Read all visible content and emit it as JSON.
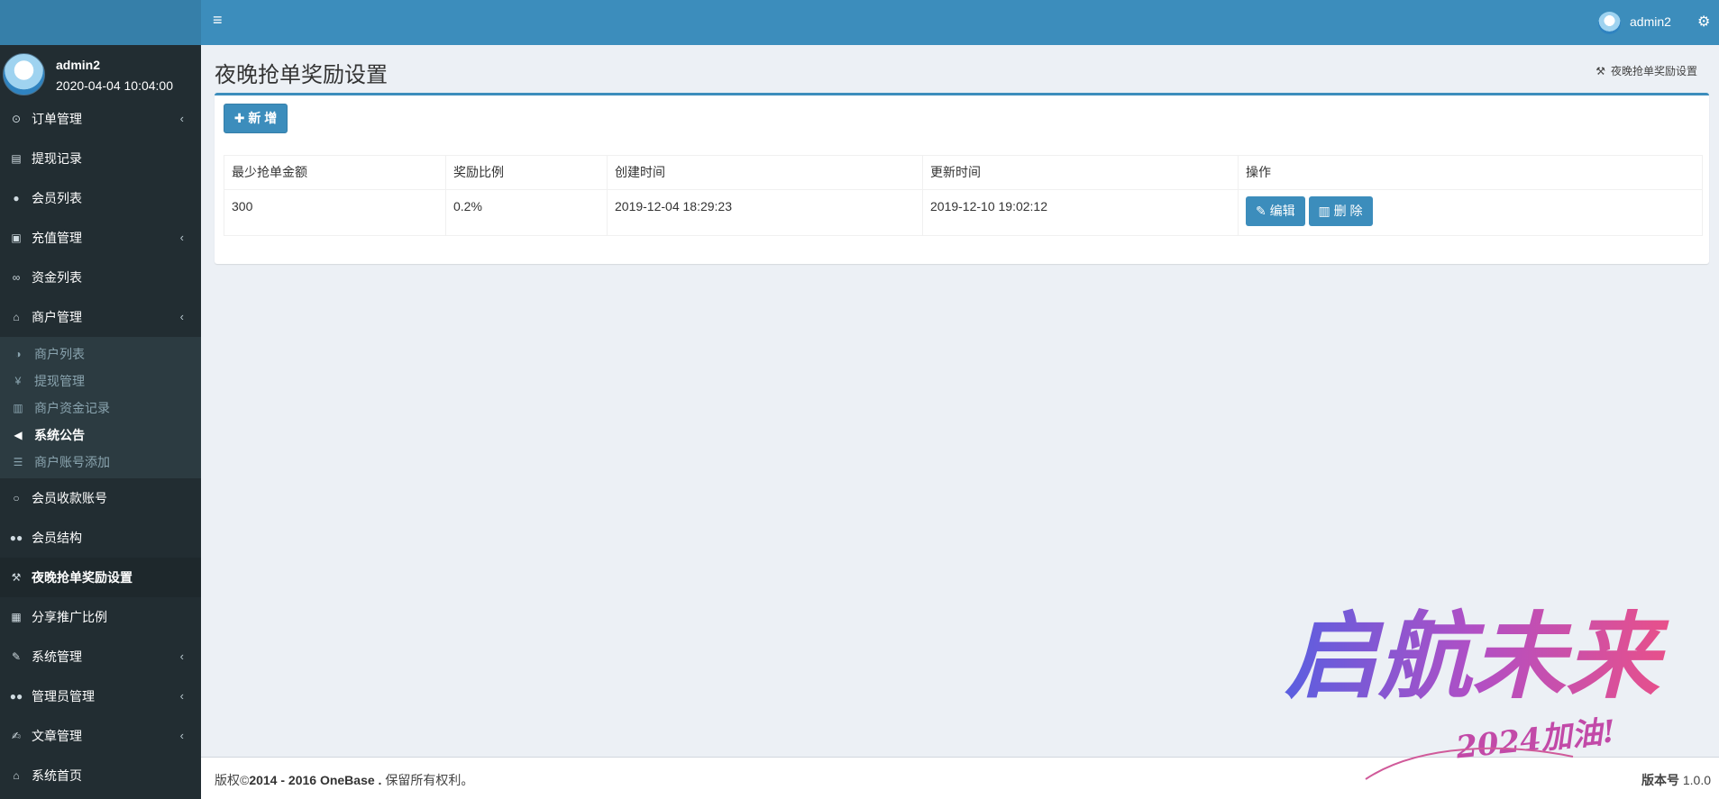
{
  "header": {
    "menu_icon": "bars-icon",
    "username": "admin2",
    "settings_icon": "gears-icon"
  },
  "sidebar": {
    "user": {
      "name": "admin2",
      "time": "2020-04-04 10:04:00"
    },
    "items": [
      {
        "label": "订单管理",
        "icon": "circle-dot-icon",
        "chev": "‹"
      },
      {
        "label": "提现记录",
        "icon": "list-alt-icon"
      },
      {
        "label": "会员列表",
        "icon": "user-icon"
      },
      {
        "label": "充值管理",
        "icon": "image-icon",
        "chev": "‹"
      },
      {
        "label": "资金列表",
        "icon": "link-icon"
      },
      {
        "label": "商户管理",
        "icon": "bank-icon",
        "chev": "‹"
      }
    ],
    "subitems": [
      {
        "label": "商户列表",
        "icon": "adjust-icon"
      },
      {
        "label": "提现管理",
        "icon": "yen-icon"
      },
      {
        "label": "商户资金记录",
        "icon": "bar-chart-icon"
      },
      {
        "label": "系统公告",
        "icon": "bullhorn-icon"
      },
      {
        "label": "商户账号添加",
        "icon": "indent-icon"
      }
    ],
    "items2": [
      {
        "label": "会员收款账号",
        "icon": "circle-icon"
      },
      {
        "label": "会员结构",
        "icon": "users-icon"
      },
      {
        "label": "夜晚抢单奖励设置",
        "icon": "gavel-icon"
      },
      {
        "label": "分享推广比例",
        "icon": "linkedin-icon"
      },
      {
        "label": "系统管理",
        "icon": "wrench-icon",
        "chev": "‹"
      },
      {
        "label": "管理员管理",
        "icon": "users-icon",
        "chev": "‹"
      },
      {
        "label": "文章管理",
        "icon": "edit-icon",
        "chev": "‹"
      },
      {
        "label": "系统首页",
        "icon": "home-icon"
      }
    ]
  },
  "page": {
    "title": "夜晚抢单奖励设置",
    "breadcrumb": "夜晚抢单奖励设置",
    "add_button": "新 增"
  },
  "table": {
    "headers": [
      "最少抢单金额",
      "奖励比例",
      "创建时间",
      "更新时间",
      "操作"
    ],
    "rows": [
      {
        "min_amount": "300",
        "ratio": "0.2%",
        "created": "2019-12-04 18:29:23",
        "updated": "2019-12-10 19:02:12",
        "edit_label": "编辑",
        "delete_label": "删 除"
      }
    ]
  },
  "footer": {
    "prefix": "版权©",
    "years": "2014 - 2016",
    "brand": "OneBase .",
    "rights": "保留所有权利。",
    "version_label": "版本号",
    "version": "1.0.0"
  },
  "watermark": {
    "main": "启航未来",
    "sub": "2024加油!"
  }
}
